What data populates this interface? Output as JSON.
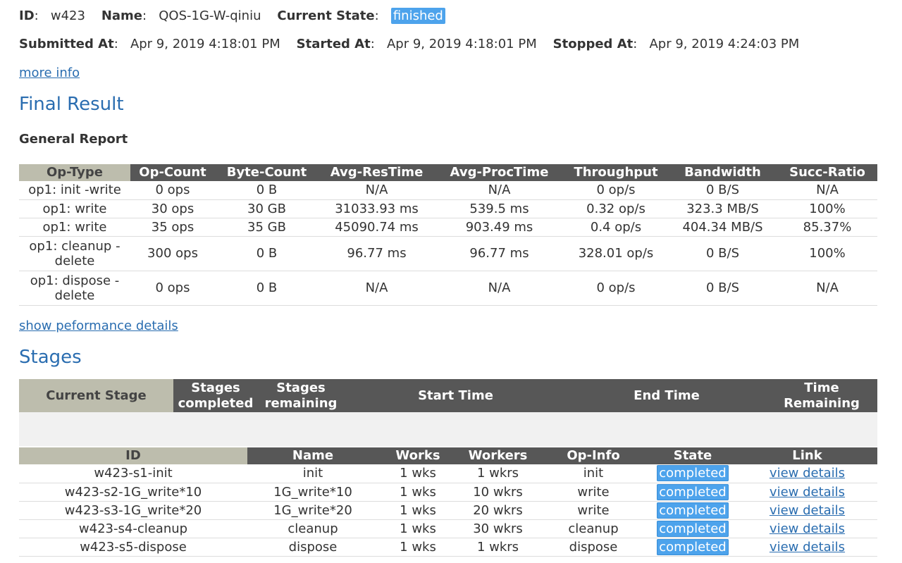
{
  "workload": {
    "id_label": "ID",
    "id": "w423",
    "name_label": "Name",
    "name": "QOS-1G-W-qiniu",
    "state_label": "Current State",
    "state": "finished",
    "submitted_label": "Submitted At",
    "submitted": "Apr 9, 2019 4:18:01 PM",
    "started_label": "Started At",
    "started": "Apr 9, 2019 4:18:01 PM",
    "stopped_label": "Stopped At",
    "stopped": "Apr 9, 2019 4:24:03 PM",
    "more_info": "more info"
  },
  "final_result": {
    "title": "Final Result",
    "general_report": "General Report",
    "columns": [
      "Op-Type",
      "Op-Count",
      "Byte-Count",
      "Avg-ResTime",
      "Avg-ProcTime",
      "Throughput",
      "Bandwidth",
      "Succ-Ratio"
    ],
    "rows": [
      [
        "op1: init -write",
        "0 ops",
        "0 B",
        "N/A",
        "N/A",
        "0 op/s",
        "0 B/S",
        "N/A"
      ],
      [
        "op1: write",
        "30 ops",
        "30 GB",
        "31033.93 ms",
        "539.5 ms",
        "0.32 op/s",
        "323.3 MB/S",
        "100%"
      ],
      [
        "op1: write",
        "35 ops",
        "35 GB",
        "45090.74 ms",
        "903.49 ms",
        "0.4 op/s",
        "404.34 MB/S",
        "85.37%"
      ],
      [
        "op1: cleanup - delete",
        "300 ops",
        "0 B",
        "96.77 ms",
        "96.77 ms",
        "328.01 op/s",
        "0 B/S",
        "100%"
      ],
      [
        "op1: dispose - delete",
        "0 ops",
        "0 B",
        "N/A",
        "N/A",
        "0 op/s",
        "0 B/S",
        "N/A"
      ]
    ],
    "perf_link": "show peformance details"
  },
  "stages": {
    "title": "Stages",
    "summary_columns": [
      "Current Stage",
      "Stages completed",
      "Stages remaining",
      "Start Time",
      "End Time",
      "Time Remaining"
    ],
    "columns": [
      "ID",
      "Name",
      "Works",
      "Workers",
      "Op-Info",
      "State",
      "Link"
    ],
    "rows": [
      {
        "id": "w423-s1-init",
        "name": "init",
        "works": "1 wks",
        "workers": "1 wkrs",
        "op": "init",
        "state": "completed",
        "link": "view details"
      },
      {
        "id": "w423-s2-1G_write*10",
        "name": "1G_write*10",
        "works": "1 wks",
        "workers": "10 wkrs",
        "op": "write",
        "state": "completed",
        "link": "view details"
      },
      {
        "id": "w423-s3-1G_write*20",
        "name": "1G_write*20",
        "works": "1 wks",
        "workers": "20 wkrs",
        "op": "write",
        "state": "completed",
        "link": "view details"
      },
      {
        "id": "w423-s4-cleanup",
        "name": "cleanup",
        "works": "1 wks",
        "workers": "30 wkrs",
        "op": "cleanup",
        "state": "completed",
        "link": "view details"
      },
      {
        "id": "w423-s5-dispose",
        "name": "dispose",
        "works": "1 wks",
        "workers": "1 wkrs",
        "op": "dispose",
        "state": "completed",
        "link": "view details"
      }
    ]
  },
  "colors": {
    "accent_link": "#2a6db0",
    "badge": "#4da3ec",
    "header_dark": "#575757",
    "header_lead": "#bdbdad"
  }
}
